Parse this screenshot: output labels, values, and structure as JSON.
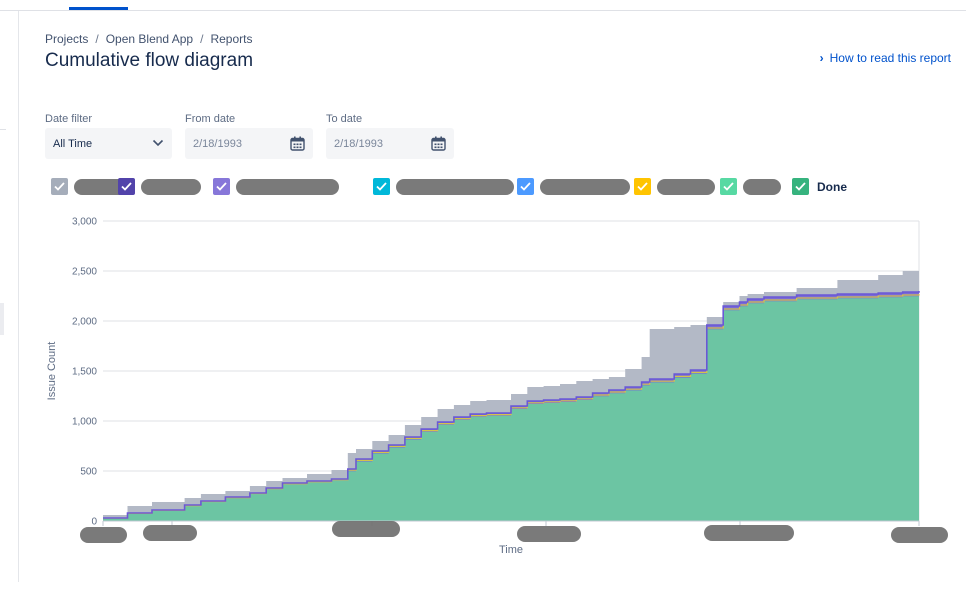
{
  "breadcrumb": [
    "Projects",
    "Open Blend App",
    "Reports"
  ],
  "page": {
    "title": "Cumulative flow diagram"
  },
  "help_link": {
    "label": "How to read this report"
  },
  "filters": {
    "date_filter": {
      "label": "Date filter",
      "value": "All Time"
    },
    "from_date": {
      "label": "From date",
      "value": "2/18/1993"
    },
    "to_date": {
      "label": "To date",
      "value": "2/18/1993"
    }
  },
  "legend": [
    {
      "label": "",
      "color": "#a5adba",
      "checked": true,
      "redacted": true
    },
    {
      "label": "",
      "color": "#5243aa",
      "checked": true,
      "redacted": true
    },
    {
      "label": "",
      "color": "#8777d9",
      "checked": true,
      "redacted": true
    },
    {
      "label": "",
      "color": "#00b8d9",
      "checked": true,
      "redacted": true
    },
    {
      "label": "",
      "color": "#4c9aff",
      "checked": true,
      "redacted": true
    },
    {
      "label": "",
      "color": "#ffc400",
      "checked": true,
      "redacted": true
    },
    {
      "label": "",
      "color": "#57d9a3",
      "checked": true,
      "redacted": true
    },
    {
      "label": "Done",
      "color": "#36b37e",
      "checked": true,
      "redacted": false
    }
  ],
  "chart_data": {
    "type": "area",
    "stacked": true,
    "xlabel": "Time",
    "ylabel": "Issue Count",
    "ylim": [
      0,
      3000
    ],
    "yticks": [
      0,
      500,
      1000,
      1500,
      2000,
      2500,
      3000
    ],
    "ytick_labels": [
      "0",
      "500",
      "1,000",
      "1,500",
      "2,000",
      "2,500",
      "3,000"
    ],
    "x_tick_labels_redacted": 5,
    "grid": true,
    "x": [
      0,
      0.03,
      0.06,
      0.1,
      0.12,
      0.15,
      0.18,
      0.2,
      0.22,
      0.25,
      0.28,
      0.3,
      0.31,
      0.33,
      0.35,
      0.37,
      0.39,
      0.41,
      0.43,
      0.45,
      0.47,
      0.5,
      0.52,
      0.54,
      0.56,
      0.58,
      0.6,
      0.62,
      0.64,
      0.66,
      0.67,
      0.7,
      0.72,
      0.74,
      0.76,
      0.78,
      0.79,
      0.81,
      0.85,
      0.9,
      0.95,
      0.98,
      1.0
    ],
    "series": [
      {
        "name": "",
        "color": "#b3b9c6",
        "values": [
          60,
          150,
          190,
          230,
          270,
          300,
          350,
          400,
          430,
          470,
          510,
          680,
          720,
          800,
          860,
          960,
          1040,
          1120,
          1160,
          1200,
          1210,
          1270,
          1340,
          1350,
          1370,
          1400,
          1420,
          1440,
          1520,
          1640,
          1920,
          1940,
          1960,
          2040,
          2190,
          2250,
          2270,
          2290,
          2330,
          2410,
          2460,
          2500,
          2520
        ]
      },
      {
        "name": "",
        "color": "#7a6ad6",
        "values": [
          30,
          80,
          110,
          160,
          200,
          240,
          280,
          330,
          380,
          400,
          420,
          520,
          620,
          700,
          760,
          840,
          920,
          990,
          1040,
          1070,
          1080,
          1150,
          1200,
          1210,
          1220,
          1240,
          1280,
          1310,
          1340,
          1390,
          1420,
          1470,
          1510,
          1960,
          2150,
          2190,
          2220,
          2240,
          2260,
          2270,
          2280,
          2290,
          2300
        ]
      },
      {
        "name": "",
        "color": "#d4c34a",
        "values": [
          28,
          76,
          106,
          154,
          195,
          234,
          275,
          324,
          372,
          392,
          412,
          508,
          606,
          686,
          746,
          826,
          904,
          974,
          1024,
          1054,
          1064,
          1132,
          1182,
          1192,
          1202,
          1222,
          1260,
          1290,
          1318,
          1368,
          1398,
          1446,
          1486,
          1930,
          2120,
          2160,
          2190,
          2210,
          2230,
          2240,
          2250,
          2260,
          2270
        ]
      },
      {
        "name": "Done",
        "color": "#6ccaa0",
        "values": [
          25,
          72,
          102,
          150,
          190,
          228,
          270,
          318,
          365,
          385,
          405,
          498,
          595,
          675,
          735,
          815,
          892,
          962,
          1012,
          1042,
          1052,
          1120,
          1170,
          1180,
          1190,
          1210,
          1248,
          1278,
          1306,
          1356,
          1386,
          1434,
          1474,
          1918,
          2108,
          2148,
          2178,
          2198,
          2218,
          2228,
          2238,
          2248,
          2258
        ]
      }
    ]
  }
}
